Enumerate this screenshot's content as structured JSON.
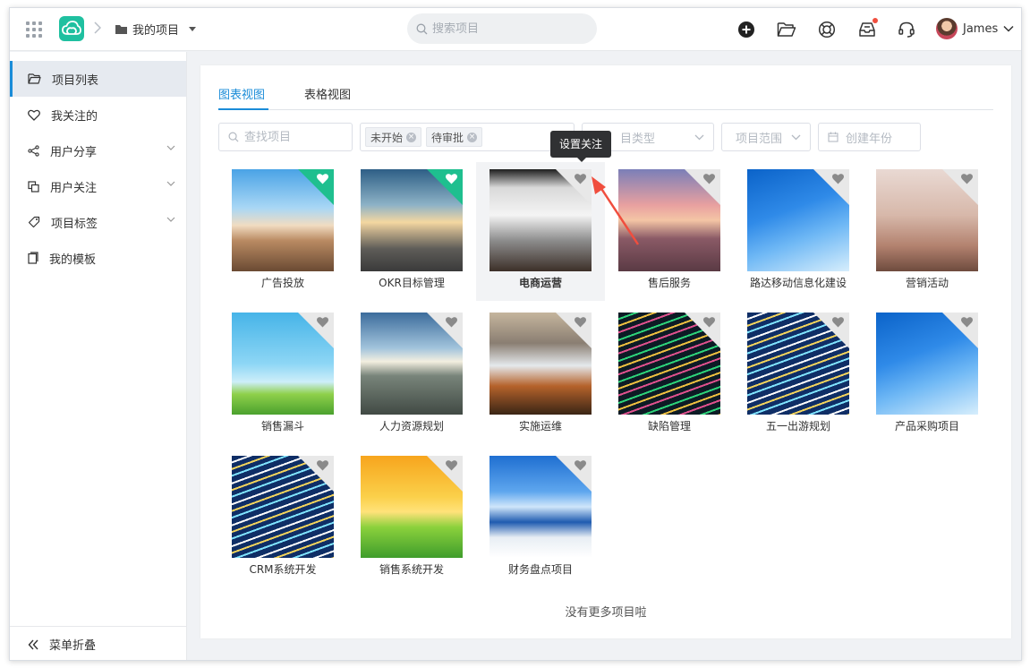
{
  "header": {
    "breadcrumb": "我的项目",
    "search_placeholder": "搜索项目",
    "user_name": "James",
    "colors": {
      "brand": "#1fc0a0",
      "accent": "#1a8cd8",
      "notify": "#f04e3e"
    }
  },
  "sidebar": {
    "items": [
      {
        "label": "项目列表",
        "icon": "folder-icon",
        "active": true
      },
      {
        "label": "我关注的",
        "icon": "heart-icon"
      },
      {
        "label": "用户分享",
        "icon": "share-icon",
        "expandable": true
      },
      {
        "label": "用户关注",
        "icon": "copy-icon",
        "expandable": true
      },
      {
        "label": "项目标签",
        "icon": "tag-icon",
        "expandable": true
      },
      {
        "label": "我的模板",
        "icon": "template-icon"
      }
    ],
    "collapse_label": "菜单折叠"
  },
  "main": {
    "tabs": [
      {
        "label": "图表视图",
        "active": true
      },
      {
        "label": "表格视图"
      }
    ],
    "filters": {
      "search_placeholder": "查找项目",
      "status_tags": [
        "未开始",
        "待审批"
      ],
      "type_placeholder": "项目类型",
      "type_visible": "目类型",
      "range_placeholder": "项目范围",
      "year_placeholder": "创建年份"
    },
    "tooltip": "设置关注",
    "projects": [
      {
        "name": "广告投放",
        "favorite": true,
        "img": "pier-sky"
      },
      {
        "name": "OKR目标管理",
        "favorite": true,
        "img": "road-sunset"
      },
      {
        "name": "电商运营",
        "favorite": false,
        "img": "interior"
      },
      {
        "name": "售后服务",
        "favorite": false,
        "img": "pier-dusk"
      },
      {
        "name": "路达移动信息化建设",
        "favorite": false,
        "img": "blue-winter"
      },
      {
        "name": "营销活动",
        "favorite": false,
        "img": "eiffel-clock"
      },
      {
        "name": "销售漏斗",
        "favorite": false,
        "img": "cartoon-kids"
      },
      {
        "name": "人力资源规划",
        "favorite": false,
        "img": "aerial-sun"
      },
      {
        "name": "实施运维",
        "favorite": false,
        "img": "mountain-lake"
      },
      {
        "name": "缺陷管理",
        "favorite": false,
        "img": "code-dark"
      },
      {
        "name": "五一出游规划",
        "favorite": false,
        "img": "code-blue"
      },
      {
        "name": "产品采购项目",
        "favorite": false,
        "img": "blue-winter"
      },
      {
        "name": "CRM系统开发",
        "favorite": false,
        "img": "code-blue"
      },
      {
        "name": "销售系统开发",
        "favorite": false,
        "img": "cartoon-hills"
      },
      {
        "name": "财务盘点项目",
        "favorite": false,
        "img": "santorini"
      }
    ],
    "no_more_text": "没有更多项目啦"
  }
}
